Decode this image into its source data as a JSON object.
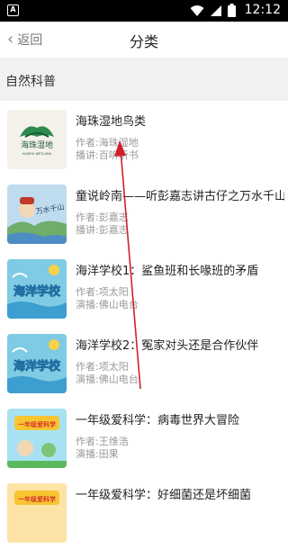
{
  "status_bar": {
    "app_badge": "A",
    "time": "12:12"
  },
  "header": {
    "back_label": "返回",
    "title": "分类"
  },
  "section": {
    "label": "自然科普"
  },
  "items": [
    {
      "title": "海珠湿地鸟类",
      "author": "作者:海珠湿地",
      "narrator": "播讲:百听听书"
    },
    {
      "title": "童说岭南——听彭嘉志讲古仔之万水千山",
      "author": "作者:彭嘉志",
      "narrator": "播讲:彭嘉志"
    },
    {
      "title": "海洋学校1：鲨鱼班和长喙班的矛盾",
      "author": "作者:项太阳",
      "narrator": "演播:佛山电台"
    },
    {
      "title": "海洋学校2：冤家对头还是合作伙伴",
      "author": "作者:项太阳",
      "narrator": "演播:佛山电台"
    },
    {
      "title": "一年级爱科学：病毒世界大冒险",
      "author": "作者:王维浩",
      "narrator": "演播:田果"
    },
    {
      "title": "一年级爱科学：好细菌还是坏细菌",
      "author": "",
      "narrator": ""
    }
  ],
  "thumbs": {
    "wetland": {
      "logo_text": "海珠湿地",
      "logo_sub": "HAIZHU WETLAND"
    },
    "ocean_school": {
      "logo_text": "海洋学校"
    },
    "science": {
      "logo_text": "一年级爱科学"
    },
    "lingnan": {
      "logo_text": "万水千山"
    }
  },
  "colors": {
    "arrow": "#d0202a",
    "status_bg": "#000000",
    "section_bg": "#f1f1f1"
  }
}
